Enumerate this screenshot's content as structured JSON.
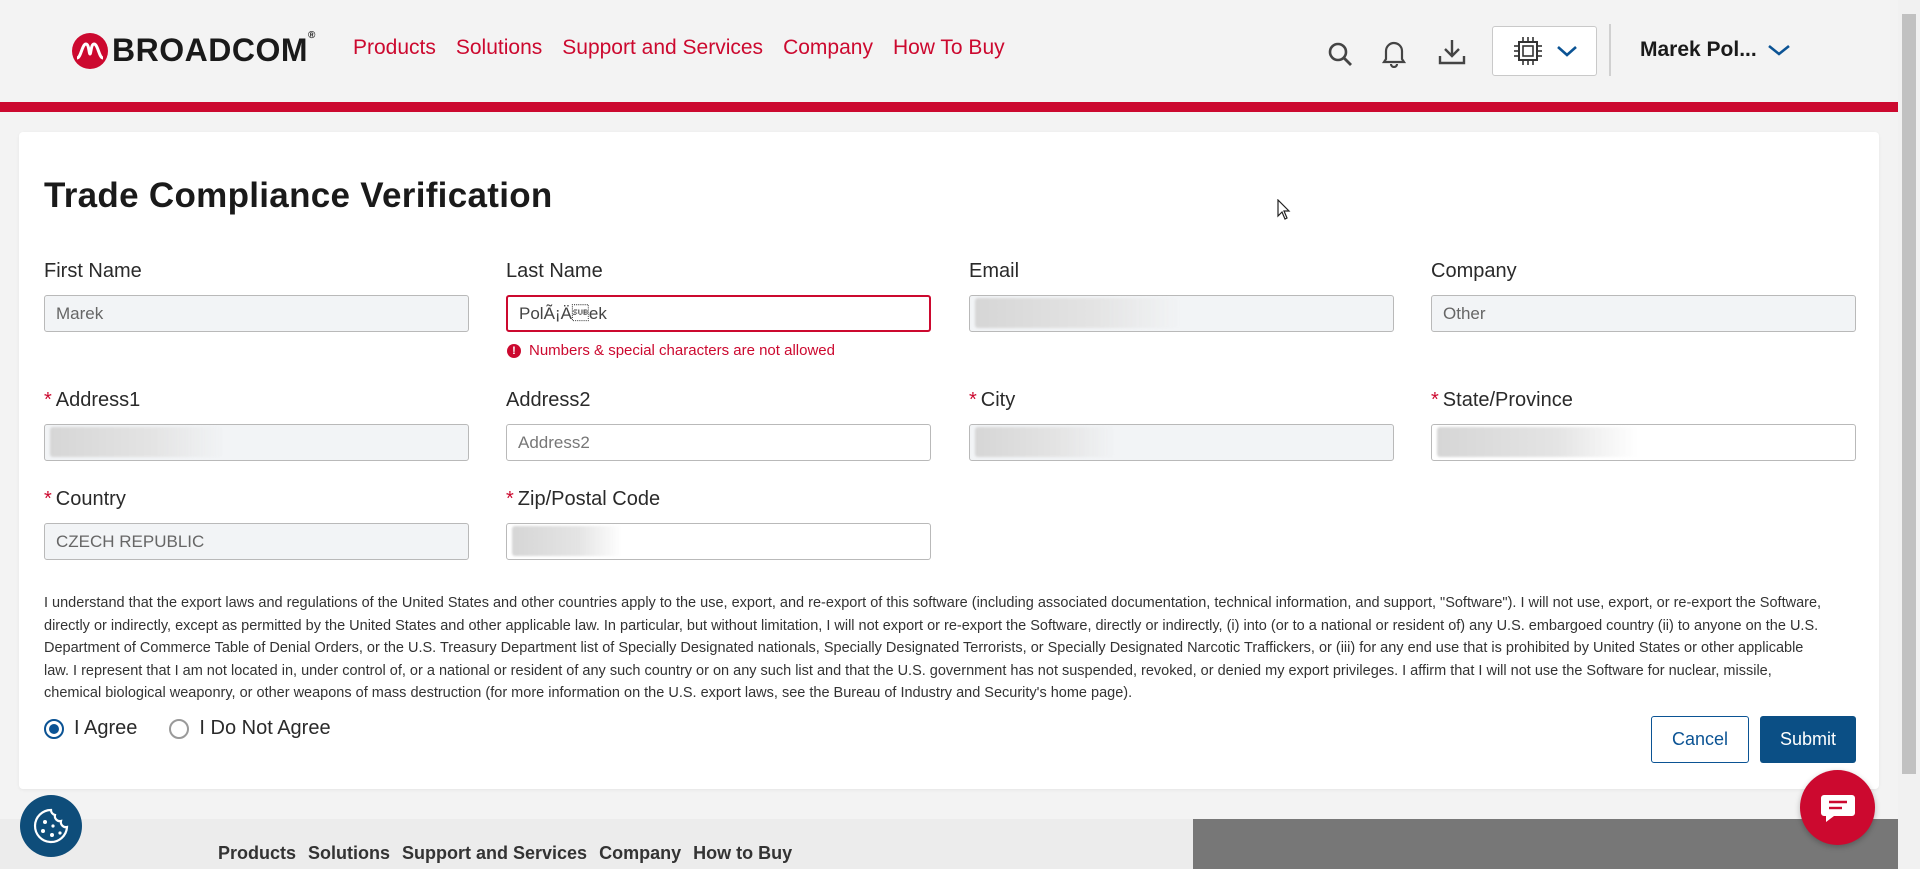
{
  "header": {
    "logo_text": "BROADCOM",
    "logo_reg": "®",
    "nav": [
      "Products",
      "Solutions",
      "Support and Services",
      "Company",
      "How To Buy"
    ],
    "user_name": "Marek Pol..."
  },
  "form": {
    "title": "Trade Compliance Verification",
    "fields": {
      "first_name": {
        "label": "First Name",
        "value": "Marek"
      },
      "last_name": {
        "label": "Last Name",
        "value": "PolÃ¡Ä\u001aek",
        "error": "Numbers & special characters are not allowed"
      },
      "email": {
        "label": "Email"
      },
      "company": {
        "label": "Company",
        "value": "Other"
      },
      "address1": {
        "label": "Address1",
        "required_mark": "*"
      },
      "address2": {
        "label": "Address2",
        "placeholder": "Address2"
      },
      "city": {
        "label": "City",
        "required_mark": "*"
      },
      "state": {
        "label": "State/Province",
        "required_mark": "*"
      },
      "country": {
        "label": "Country",
        "required_mark": "*",
        "value": "CZECH REPUBLIC"
      },
      "zip": {
        "label": "Zip/Postal Code",
        "required_mark": "*"
      }
    },
    "legal_text": "I understand that the export laws and regulations of the United States and other countries apply to the use, export, and re-export of this software (including associated documentation, technical information, and support, \"Software\"). I will not use, export, or re-export the Software, directly or indirectly, except as permitted by the United States and other applicable law. In particular, but without limitation, I will not export or re-export the Software, directly or indirectly, (i) into (or to a national or resident of) any U.S. embargoed country (ii) to anyone on the U.S. Department of Commerce Table of Denial Orders, or the U.S. Treasury Department list of Specially Designated nationals, Specially Designated Terrorists, or Specially Designated Narcotic Traffickers, or (iii) for any end use that is prohibited by United States or other applicable law. I represent that I am not located in, under control of, or a national or resident of any such country or on any such list and that the U.S. government has not suspended, revoked, or denied my export privileges. I affirm that I will not use the Software for nuclear, missile, chemical biological weaponry, or other weapons of mass destruction (for more information on the U.S. export laws, see the Bureau of Industry and Security's home page).",
    "agree_label": "I Agree",
    "disagree_label": "I Do Not Agree",
    "agree_selected": true,
    "cancel_label": "Cancel",
    "submit_label": "Submit"
  },
  "footer": {
    "nav": [
      "Products",
      "Solutions",
      "Support and Services",
      "Company",
      "How to Buy"
    ]
  },
  "colors": {
    "brand_red": "#cc092f",
    "primary_blue": "#0b4f85",
    "cookie_blue": "#0e4d7a"
  },
  "icons": [
    "search-icon",
    "bell-icon",
    "download-icon",
    "chip-icon",
    "chevron-down-icon",
    "error-icon",
    "cookie-icon",
    "chat-icon"
  ]
}
